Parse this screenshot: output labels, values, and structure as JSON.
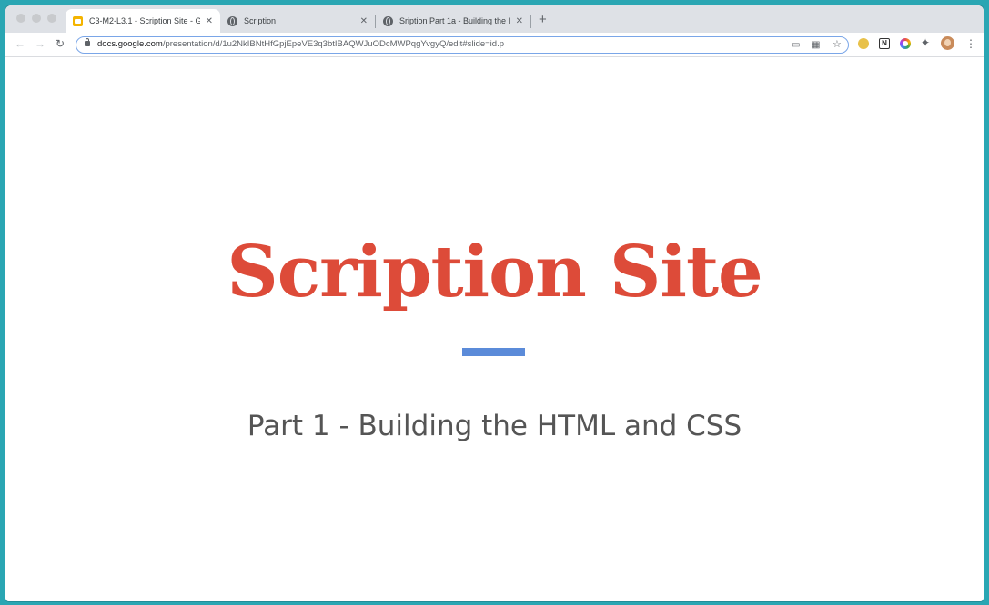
{
  "browser": {
    "tabs": [
      {
        "title": "C3-M2-L3.1 - Scription Site - G",
        "favicon": "slides-icon",
        "active": true
      },
      {
        "title": "Scription",
        "favicon": "globe-icon",
        "active": false
      },
      {
        "title": "Sription Part 1a - Building the H",
        "favicon": "globe-icon",
        "active": false
      }
    ],
    "new_tab_label": "+",
    "close_label": "✕",
    "url_host": "docs.google.com",
    "url_path": "/presentation/d/1u2NkIBNtHfGpjEpeVE3q3btIBAQWJuODcMWPqgYvgyQ/edit#slide=id.p"
  },
  "slide": {
    "title": "Scription Site",
    "subtitle": "Part 1 - Building the HTML and CSS",
    "title_color": "#dd4b39",
    "accent_color": "#5b8bd9"
  }
}
